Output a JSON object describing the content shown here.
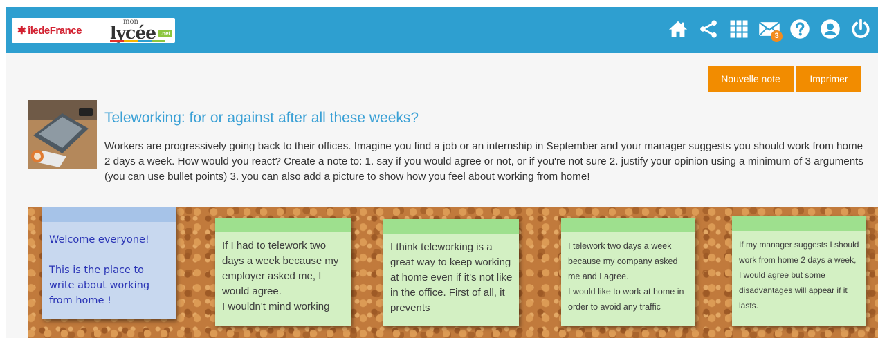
{
  "header": {
    "brand_region": "îledeFrance",
    "brand_region_star": "✱",
    "brand_lycee_top": "mon",
    "brand_lycee": "lycée",
    "brand_lycee_suffix": ".net",
    "mail_count": "3",
    "icons": [
      "home-icon",
      "share-icon",
      "apps-grid-icon",
      "mail-icon",
      "help-icon",
      "user-icon",
      "power-icon"
    ]
  },
  "toolbar": {
    "new_note_label": "Nouvelle note",
    "print_label": "Imprimer"
  },
  "topic": {
    "title": "Teleworking: for or against after all these weeks?",
    "description": "Workers are progressively going back to their offices. Imagine you find a job or an internship in September and your manager suggests you should work from home 2 days a week. How would you react? Create a note to: 1. say if you would agree or not, or if you're not sure 2. justify your opinion using a minimum of 3 arguments (you can use bullet points) 3. you can also add a picture to show how you feel about working from home!"
  },
  "notes": [
    {
      "color": "blue",
      "text": "Welcome everyone!\n\nThis is the place to write about working from home !"
    },
    {
      "color": "green",
      "text": "If I had to telework two days a week because my employer asked me, I would agree.\nI wouldn't mind working"
    },
    {
      "color": "green",
      "text": "I think teleworking is a great way to keep working at home even if it's not like in the office. First of all, it prevents"
    },
    {
      "color": "green",
      "text": "I telework two days a week because my company asked me and I agree.\nI would like to work at home in order to avoid any traffic"
    },
    {
      "color": "green",
      "text": "If my manager suggests I should work from home 2 days a week, I would agree but some disadvantages will appear if it lasts."
    }
  ],
  "colors": {
    "header": "#2e9fd0",
    "accent_button": "#f28c00",
    "title": "#3aa0d5",
    "note_blue": "#c8d8ef",
    "note_green": "#d3f0c3",
    "cork": "#c17a3c"
  }
}
